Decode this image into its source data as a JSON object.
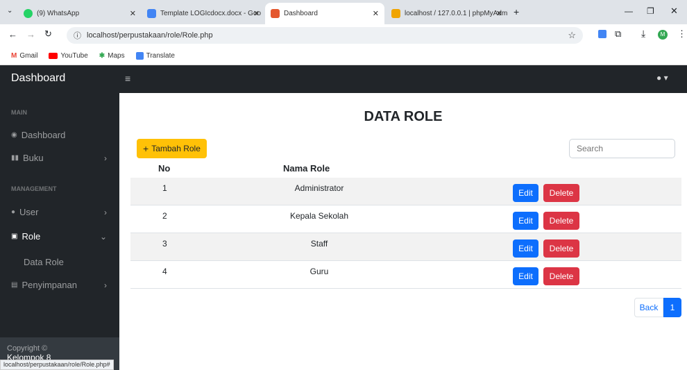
{
  "browser": {
    "tabs": [
      {
        "label": "(9) WhatsApp"
      },
      {
        "label": "Template LOGIcdocx.docx - Goo"
      },
      {
        "label": "Dashboard"
      },
      {
        "label": "localhost / 127.0.0.1 | phpMyAdmi"
      }
    ],
    "new_tab": "+",
    "url": "localhost/perpustakaan/role/Role.php",
    "bookmarks": [
      "Gmail",
      "YouTube",
      "Maps",
      "Translate"
    ],
    "status_url": "localhost/perpustakaan/role/Role.php#"
  },
  "navbar": {
    "brand": "Dashboard",
    "menu_icon": "≡",
    "user_icon": "user-icon"
  },
  "sidebar": {
    "section_main": "MAIN",
    "section_management": "MANAGEMENT",
    "items": [
      {
        "label": "Dashboard",
        "icon": "dashboard-icon"
      },
      {
        "label": "Buku",
        "icon": "book-icon"
      },
      {
        "label": "User",
        "icon": "user-icon"
      },
      {
        "label": "Role",
        "icon": "role-icon"
      },
      {
        "label": "Data Role"
      },
      {
        "label": "Penyimpanan",
        "icon": "storage-icon"
      }
    ],
    "footer_line1": "Copyright ©",
    "footer_line2": "Kelompok 8"
  },
  "main": {
    "title": "DATA ROLE",
    "add_button": "Tambah Role",
    "search_placeholder": "Search",
    "columns": [
      "No",
      "Nama Role"
    ],
    "rows": [
      {
        "no": "1",
        "name": "Administrator"
      },
      {
        "no": "2",
        "name": "Kepala Sekolah"
      },
      {
        "no": "3",
        "name": "Staff"
      },
      {
        "no": "4",
        "name": "Guru"
      }
    ],
    "edit_label": "Edit",
    "delete_label": "Delete",
    "pagination": {
      "back": "Back",
      "page": "1"
    }
  },
  "colors": {
    "navbar": "#212529",
    "add": "#ffc107",
    "edit": "#0d6efd",
    "delete": "#dc3545"
  }
}
